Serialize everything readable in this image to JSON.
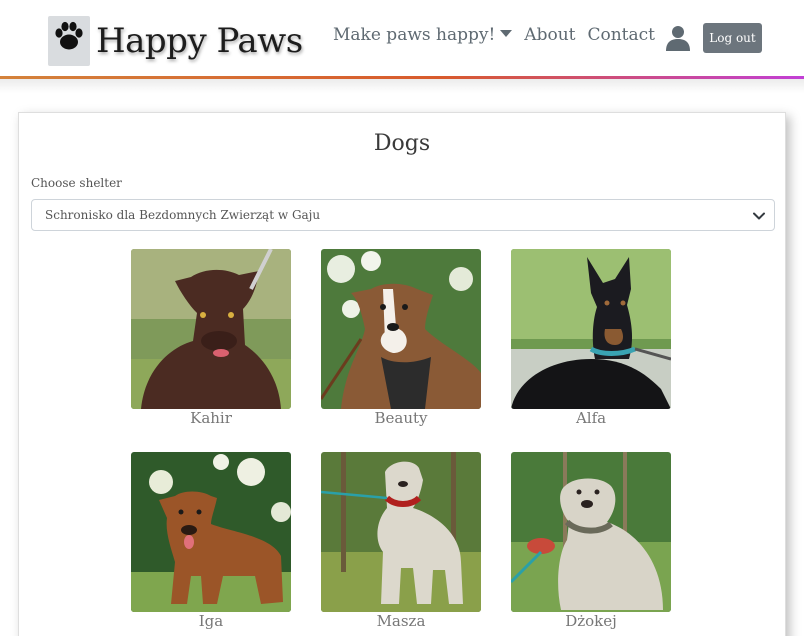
{
  "header": {
    "brand": "Happy Paws",
    "nav": [
      {
        "label": "Make paws happy!",
        "dropdown": true
      },
      {
        "label": "About"
      },
      {
        "label": "Contact"
      }
    ],
    "logout_label": "Log out",
    "accent_gradient": [
      "#d4823b",
      "#d85a2c",
      "#c23fd6"
    ]
  },
  "main": {
    "title": "Dogs",
    "shelter_label": "Choose shelter",
    "shelter_selected": "Schronisko dla Bezdomnych Zwierząt w Gaju",
    "dogs": [
      {
        "name": "Kahir"
      },
      {
        "name": "Beauty"
      },
      {
        "name": "Alfa"
      },
      {
        "name": "Iga"
      },
      {
        "name": "Masza"
      },
      {
        "name": "Dżokej"
      }
    ]
  },
  "colors": {
    "logout_button": "#6c757d",
    "logo_bg": "#d9dcdf"
  }
}
